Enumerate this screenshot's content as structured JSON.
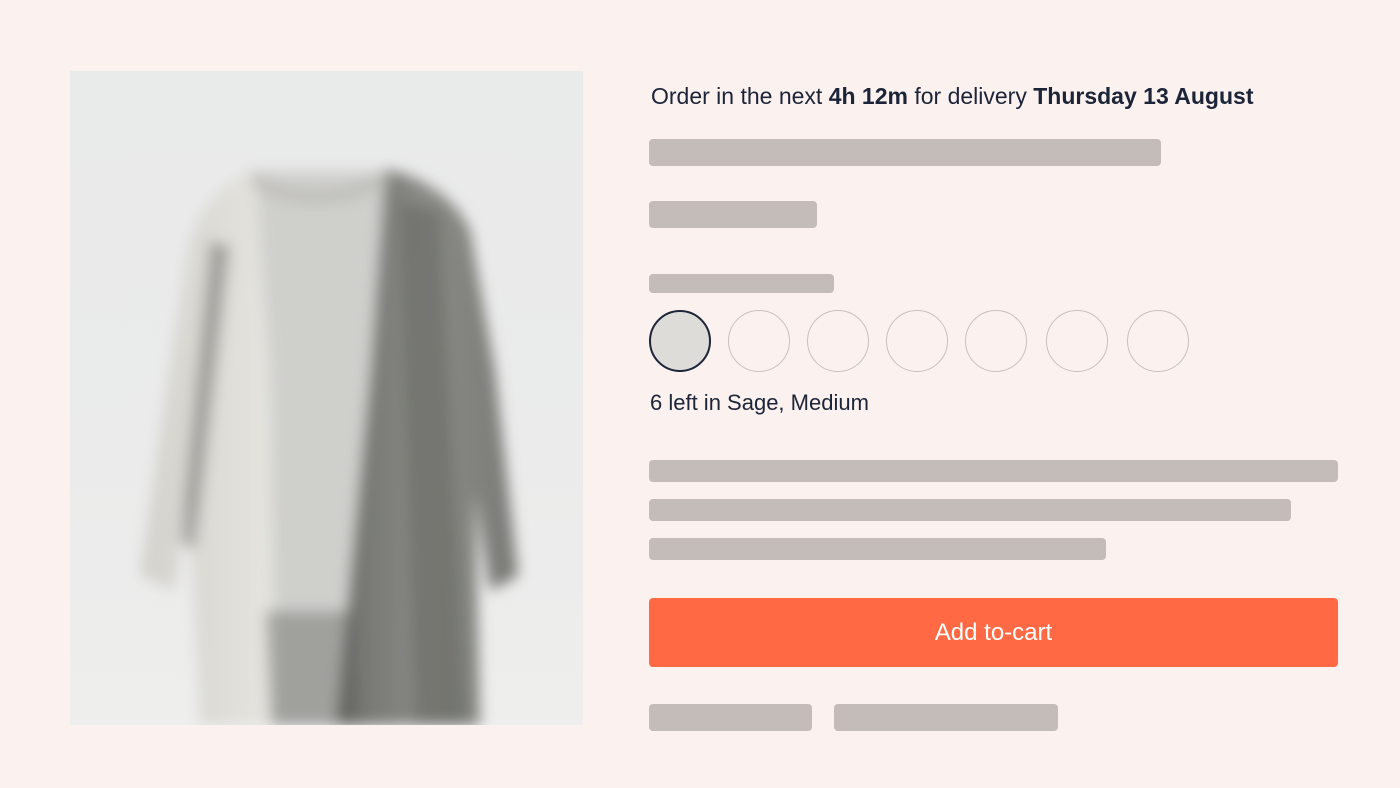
{
  "delivery": {
    "prefix": "Order in the next ",
    "time_left": "4h 12m",
    "middle": " for delivery ",
    "date": "Thursday 13 August"
  },
  "product_image": {
    "subject": "long open-front cardigan, blurred"
  },
  "swatches": {
    "count": 7,
    "selected_index": 0
  },
  "stock": {
    "text": "6 left in Sage, Medium"
  },
  "cart": {
    "add_label": "Add to-cart"
  },
  "colors": {
    "background": "#fbf1ef",
    "placeholder": "#c3bcb9",
    "text": "#1c2438",
    "accent": "#ff6a45",
    "swatch_selected_fill": "#dddcd8",
    "swatch_border": "#c8c0bd"
  }
}
